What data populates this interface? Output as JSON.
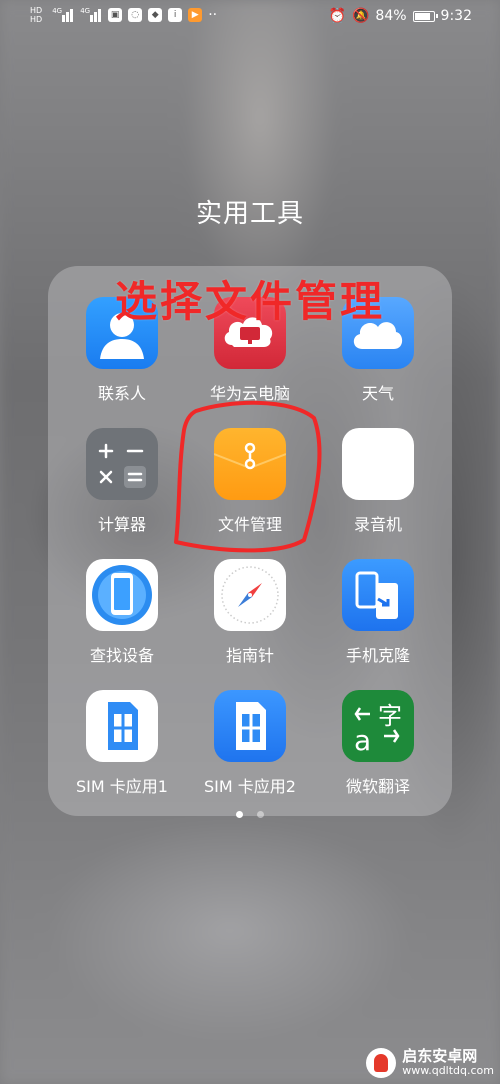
{
  "status_bar": {
    "left_hd_top": "HD",
    "left_hd_bottom": "HD",
    "signal1_label": "4G",
    "signal2_label": "4G",
    "battery": "84%",
    "time": "9:32",
    "icons": [
      "alarm-icon",
      "mute-icon",
      "battery-icon"
    ]
  },
  "folder": {
    "title": "实用工具",
    "annotation": "选择文件管理",
    "apps": [
      {
        "label": "联系人",
        "icon": "contacts-icon"
      },
      {
        "label": "华为云电脑",
        "icon": "cloud-pc-icon"
      },
      {
        "label": "天气",
        "icon": "weather-icon"
      },
      {
        "label": "计算器",
        "icon": "calculator-icon"
      },
      {
        "label": "文件管理",
        "icon": "files-icon"
      },
      {
        "label": "录音机",
        "icon": "recorder-icon"
      },
      {
        "label": "查找设备",
        "icon": "find-device-icon"
      },
      {
        "label": "指南针",
        "icon": "compass-icon"
      },
      {
        "label": "手机克隆",
        "icon": "phone-clone-icon"
      },
      {
        "label": "SIM 卡应用1",
        "icon": "sim-card-icon"
      },
      {
        "label": "SIM 卡应用2",
        "icon": "sim-card-icon"
      },
      {
        "label": "微软翻译",
        "icon": "translator-icon"
      }
    ],
    "pages": 2,
    "current_page": 1
  },
  "watermark": {
    "line1": "启东安卓网",
    "line2": "www.qdltdq.com"
  },
  "colors": {
    "annotation": "#f02828",
    "files_icon": "#ffa51f"
  }
}
